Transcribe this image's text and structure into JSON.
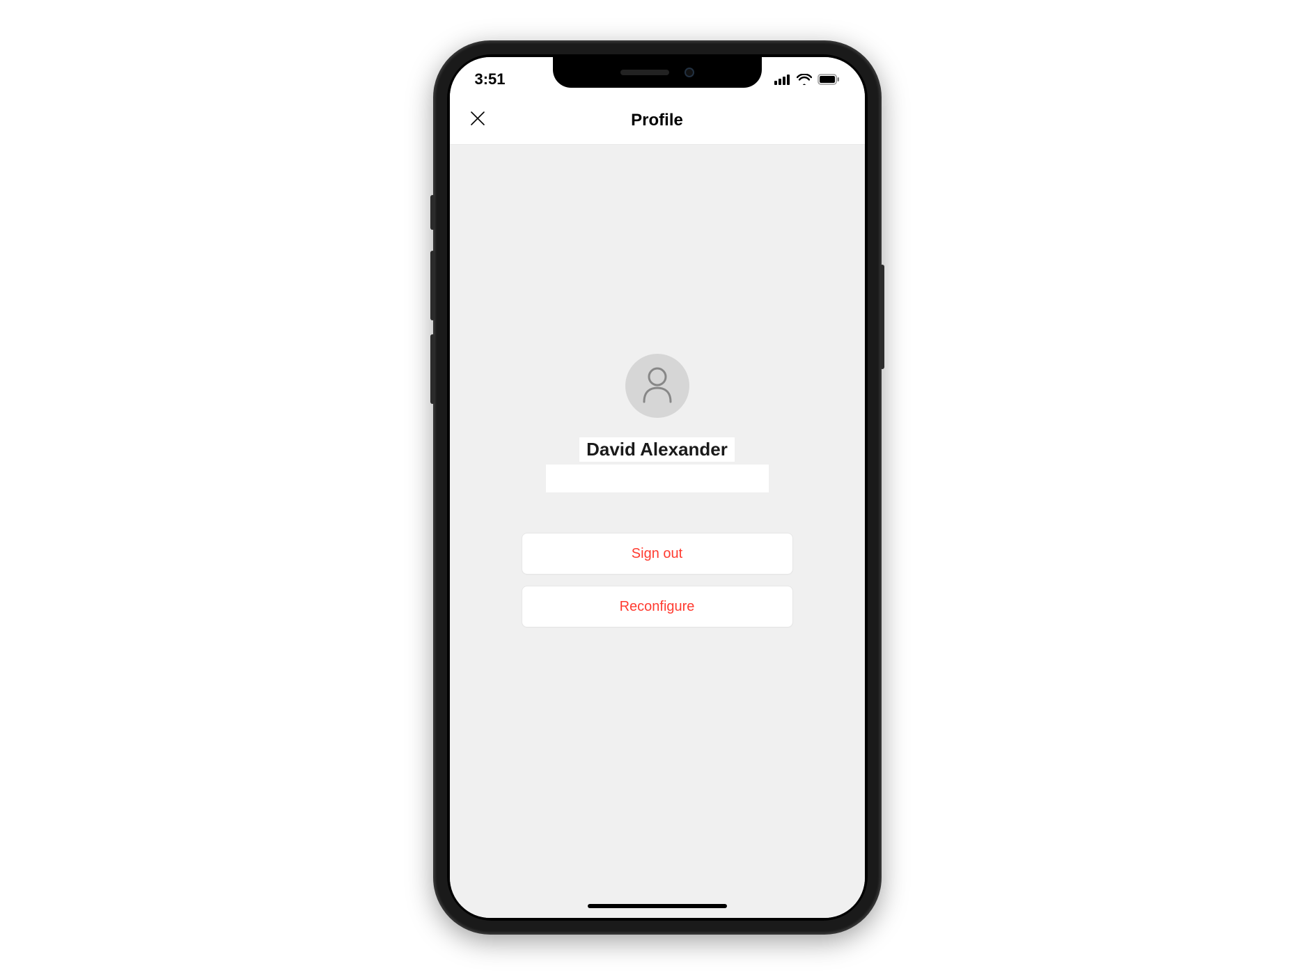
{
  "status_bar": {
    "time": "3:51"
  },
  "header": {
    "title": "Profile"
  },
  "profile": {
    "name": "David Alexander",
    "email": ""
  },
  "actions": {
    "sign_out_label": "Sign out",
    "reconfigure_label": "Reconfigure"
  },
  "colors": {
    "danger": "#ff3b30",
    "background": "#f0f0f0"
  }
}
